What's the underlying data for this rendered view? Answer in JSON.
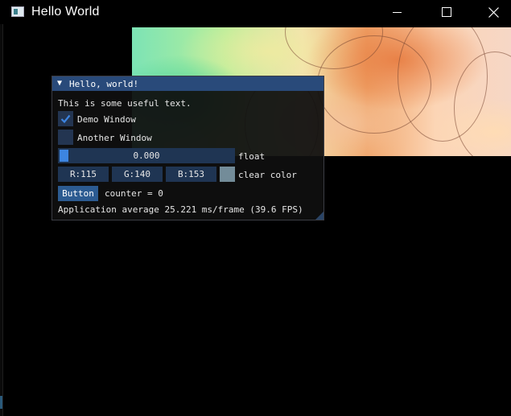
{
  "window": {
    "title": "Hello World"
  },
  "imgui": {
    "title": "Hello, world!",
    "text": "This is some useful text.",
    "demo_checkbox_label": "Demo Window",
    "demo_checked": true,
    "another_checkbox_label": "Another Window",
    "another_checked": false,
    "slider_value": "0.000",
    "slider_label": "float",
    "r": "R:115",
    "g": "G:140",
    "b": "B:153",
    "clear_color_label": "clear color",
    "clear_color": "#738c99",
    "button_label": "Button",
    "counter_text": "counter = 0",
    "fps_text": "Application average 25.221 ms/frame (39.6 FPS)"
  },
  "colors": {
    "title_bg": "#294a7a",
    "frame_bg": "#1f3553",
    "accent": "#3d85e0"
  },
  "icons": {
    "app": "app-window-icon",
    "minimize": "minimize-icon",
    "maximize": "maximize-icon",
    "close": "close-icon",
    "collapse": "triangle-down-icon",
    "check": "checkmark-icon"
  }
}
